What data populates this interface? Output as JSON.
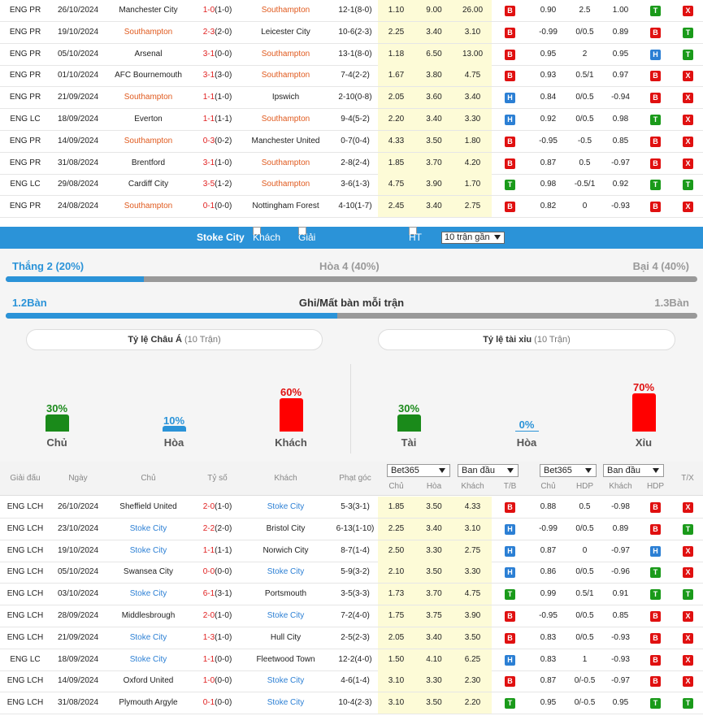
{
  "top_matches": [
    {
      "league": "ENG PR",
      "date": "26/10/2024",
      "home": "Manchester City",
      "home_hl": false,
      "score": "1-0",
      "ht": "(1-0)",
      "away": "Southampton",
      "away_hl": true,
      "corner": "12-1(8-0)",
      "o1": "1.10",
      "o2": "9.00",
      "o3": "26.00",
      "tb": "B",
      "h1": "0.90",
      "hdp": "2.5",
      "h2": "1.00",
      "r1": "T",
      "r2": "X"
    },
    {
      "league": "ENG PR",
      "date": "19/10/2024",
      "home": "Southampton",
      "home_hl": true,
      "score": "2-3",
      "ht": "(2-0)",
      "away": "Leicester City",
      "away_hl": false,
      "corner": "10-6(2-3)",
      "o1": "2.25",
      "o2": "3.40",
      "o3": "3.10",
      "tb": "B",
      "h1": "-0.99",
      "hdp": "0/0.5",
      "h2": "0.89",
      "r1": "B",
      "r2": "T"
    },
    {
      "league": "ENG PR",
      "date": "05/10/2024",
      "home": "Arsenal",
      "home_hl": false,
      "score": "3-1",
      "ht": "(0-0)",
      "away": "Southampton",
      "away_hl": true,
      "corner": "13-1(8-0)",
      "o1": "1.18",
      "o2": "6.50",
      "o3": "13.00",
      "tb": "B",
      "h1": "0.95",
      "hdp": "2",
      "h2": "0.95",
      "r1": "H",
      "r2": "T"
    },
    {
      "league": "ENG PR",
      "date": "01/10/2024",
      "home": "AFC Bournemouth",
      "home_hl": false,
      "score": "3-1",
      "ht": "(3-0)",
      "away": "Southampton",
      "away_hl": true,
      "corner": "7-4(2-2)",
      "o1": "1.67",
      "o2": "3.80",
      "o3": "4.75",
      "tb": "B",
      "h1": "0.93",
      "hdp": "0.5/1",
      "h2": "0.97",
      "r1": "B",
      "r2": "X"
    },
    {
      "league": "ENG PR",
      "date": "21/09/2024",
      "home": "Southampton",
      "home_hl": true,
      "score": "1-1",
      "ht": "(1-0)",
      "away": "Ipswich",
      "away_hl": false,
      "corner": "2-10(0-8)",
      "o1": "2.05",
      "o2": "3.60",
      "o3": "3.40",
      "tb": "H",
      "h1": "0.84",
      "hdp": "0/0.5",
      "h2": "-0.94",
      "r1": "B",
      "r2": "X"
    },
    {
      "league": "ENG LC",
      "date": "18/09/2024",
      "home": "Everton",
      "home_hl": false,
      "score": "1-1",
      "ht": "(1-1)",
      "away": "Southampton",
      "away_hl": true,
      "corner": "9-4(5-2)",
      "o1": "2.20",
      "o2": "3.40",
      "o3": "3.30",
      "tb": "H",
      "h1": "0.92",
      "hdp": "0/0.5",
      "h2": "0.98",
      "r1": "T",
      "r2": "X"
    },
    {
      "league": "ENG PR",
      "date": "14/09/2024",
      "home": "Southampton",
      "home_hl": true,
      "score": "0-3",
      "ht": "(0-2)",
      "away": "Manchester United",
      "away_hl": false,
      "corner": "0-7(0-4)",
      "o1": "4.33",
      "o2": "3.50",
      "o3": "1.80",
      "tb": "B",
      "h1": "-0.95",
      "hdp": "-0.5",
      "h2": "0.85",
      "r1": "B",
      "r2": "X"
    },
    {
      "league": "ENG PR",
      "date": "31/08/2024",
      "home": "Brentford",
      "home_hl": false,
      "score": "3-1",
      "ht": "(1-0)",
      "away": "Southampton",
      "away_hl": true,
      "corner": "2-8(2-4)",
      "o1": "1.85",
      "o2": "3.70",
      "o3": "4.20",
      "tb": "B",
      "h1": "0.87",
      "hdp": "0.5",
      "h2": "-0.97",
      "r1": "B",
      "r2": "X"
    },
    {
      "league": "ENG LC",
      "date": "29/08/2024",
      "home": "Cardiff City",
      "home_hl": false,
      "score": "3-5",
      "ht": "(1-2)",
      "away": "Southampton",
      "away_hl": true,
      "corner": "3-6(1-3)",
      "o1": "4.75",
      "o2": "3.90",
      "o3": "1.70",
      "tb": "T",
      "h1": "0.98",
      "hdp": "-0.5/1",
      "h2": "0.92",
      "r1": "T",
      "r2": "T"
    },
    {
      "league": "ENG PR",
      "date": "24/08/2024",
      "home": "Southampton",
      "home_hl": true,
      "score": "0-1",
      "ht": "(0-0)",
      "away": "Nottingham Forest",
      "away_hl": false,
      "corner": "4-10(1-7)",
      "o1": "2.45",
      "o2": "3.40",
      "o3": "2.75",
      "tb": "B",
      "h1": "0.82",
      "hdp": "0",
      "h2": "-0.93",
      "r1": "B",
      "r2": "X"
    }
  ],
  "filter": {
    "team": "Stoke City",
    "away": "Khách",
    "similar": "Giải đấu tương đồng",
    "ht": "HT",
    "range": "10 trận gần"
  },
  "summary": {
    "win": "Thắng 2 (20%)",
    "draw": "Hòa 4 (40%)",
    "loss": "Bại 4 (40%)",
    "win_frac": 0.2,
    "goals_title": "Ghi/Mất bàn mỗi trận",
    "goals_for": "1.2Bàn",
    "goals_against": "1.3Bàn"
  },
  "asian": {
    "title": "Tỷ lệ Châu Á",
    "sub": "(10 Trận)",
    "items": [
      {
        "pct": "30%",
        "label": "Chủ"
      },
      {
        "pct": "10%",
        "label": "Hòa"
      },
      {
        "pct": "60%",
        "label": "Khách"
      }
    ]
  },
  "ou": {
    "title": "Tỷ lệ tài xỉu",
    "sub": "(10 Trận)",
    "items": [
      {
        "pct": "30%",
        "label": "Tài"
      },
      {
        "pct": "0%",
        "label": "Hòa"
      },
      {
        "pct": "70%",
        "label": "Xỉu"
      }
    ]
  },
  "table_header": {
    "league": "Giải đấu",
    "date": "Ngày",
    "home": "Chủ",
    "score": "Tỷ số",
    "away": "Khách",
    "corner": "Phạt góc",
    "book1": "Bet365",
    "book2": "Ban đầu",
    "book3": "Bet365",
    "book4": "Ban đầu",
    "tx": "T/X",
    "o1": "Chủ",
    "o2": "Hòa",
    "o3": "Khách",
    "tb": "T/B",
    "h1": "Chủ",
    "hdp": "HDP",
    "h2": "Khách",
    "hdp2": "HDP"
  },
  "bottom_matches": [
    {
      "league": "ENG LCH",
      "date": "26/10/2024",
      "home": "Sheffield United",
      "home_hl": false,
      "score": "2-0",
      "ht": "(1-0)",
      "away": "Stoke City",
      "away_hl": true,
      "corner": "5-3(3-1)",
      "o1": "1.85",
      "o2": "3.50",
      "o3": "4.33",
      "tb": "B",
      "h1": "0.88",
      "hdp": "0.5",
      "h2": "-0.98",
      "r1": "B",
      "r2": "X"
    },
    {
      "league": "ENG LCH",
      "date": "23/10/2024",
      "home": "Stoke City",
      "home_hl": true,
      "score": "2-2",
      "ht": "(2-0)",
      "away": "Bristol City",
      "away_hl": false,
      "corner": "6-13(1-10)",
      "o1": "2.25",
      "o2": "3.40",
      "o3": "3.10",
      "tb": "H",
      "h1": "-0.99",
      "hdp": "0/0.5",
      "h2": "0.89",
      "r1": "B",
      "r2": "T"
    },
    {
      "league": "ENG LCH",
      "date": "19/10/2024",
      "home": "Stoke City",
      "home_hl": true,
      "score": "1-1",
      "ht": "(1-1)",
      "away": "Norwich City",
      "away_hl": false,
      "corner": "8-7(1-4)",
      "o1": "2.50",
      "o2": "3.30",
      "o3": "2.75",
      "tb": "H",
      "h1": "0.87",
      "hdp": "0",
      "h2": "-0.97",
      "r1": "H",
      "r2": "X"
    },
    {
      "league": "ENG LCH",
      "date": "05/10/2024",
      "home": "Swansea City",
      "home_hl": false,
      "score": "0-0",
      "ht": "(0-0)",
      "away": "Stoke City",
      "away_hl": true,
      "corner": "5-9(3-2)",
      "o1": "2.10",
      "o2": "3.50",
      "o3": "3.30",
      "tb": "H",
      "h1": "0.86",
      "hdp": "0/0.5",
      "h2": "-0.96",
      "r1": "T",
      "r2": "X"
    },
    {
      "league": "ENG LCH",
      "date": "03/10/2024",
      "home": "Stoke City",
      "home_hl": true,
      "score": "6-1",
      "ht": "(3-1)",
      "away": "Portsmouth",
      "away_hl": false,
      "corner": "3-5(3-3)",
      "o1": "1.73",
      "o2": "3.70",
      "o3": "4.75",
      "tb": "T",
      "h1": "0.99",
      "hdp": "0.5/1",
      "h2": "0.91",
      "r1": "T",
      "r2": "T"
    },
    {
      "league": "ENG LCH",
      "date": "28/09/2024",
      "home": "Middlesbrough",
      "home_hl": false,
      "score": "2-0",
      "ht": "(1-0)",
      "away": "Stoke City",
      "away_hl": true,
      "corner": "7-2(4-0)",
      "o1": "1.75",
      "o2": "3.75",
      "o3": "3.90",
      "tb": "B",
      "h1": "-0.95",
      "hdp": "0/0.5",
      "h2": "0.85",
      "r1": "B",
      "r2": "X"
    },
    {
      "league": "ENG LCH",
      "date": "21/09/2024",
      "home": "Stoke City",
      "home_hl": true,
      "score": "1-3",
      "ht": "(1-0)",
      "away": "Hull City",
      "away_hl": false,
      "corner": "2-5(2-3)",
      "o1": "2.05",
      "o2": "3.40",
      "o3": "3.50",
      "tb": "B",
      "h1": "0.83",
      "hdp": "0/0.5",
      "h2": "-0.93",
      "r1": "B",
      "r2": "X"
    },
    {
      "league": "ENG LC",
      "date": "18/09/2024",
      "home": "Stoke City",
      "home_hl": true,
      "score": "1-1",
      "ht": "(0-0)",
      "away": "Fleetwood Town",
      "away_hl": false,
      "corner": "12-2(4-0)",
      "o1": "1.50",
      "o2": "4.10",
      "o3": "6.25",
      "tb": "H",
      "h1": "0.83",
      "hdp": "1",
      "h2": "-0.93",
      "r1": "B",
      "r2": "X"
    },
    {
      "league": "ENG LCH",
      "date": "14/09/2024",
      "home": "Oxford United",
      "home_hl": false,
      "score": "1-0",
      "ht": "(0-0)",
      "away": "Stoke City",
      "away_hl": true,
      "corner": "4-6(1-4)",
      "o1": "3.10",
      "o2": "3.30",
      "o3": "2.30",
      "tb": "B",
      "h1": "0.87",
      "hdp": "0/-0.5",
      "h2": "-0.97",
      "r1": "B",
      "r2": "X"
    },
    {
      "league": "ENG LCH",
      "date": "31/08/2024",
      "home": "Plymouth Argyle",
      "home_hl": false,
      "score": "0-1",
      "ht": "(0-0)",
      "away": "Stoke City",
      "away_hl": true,
      "corner": "10-4(2-3)",
      "o1": "3.10",
      "o2": "3.50",
      "o3": "2.20",
      "tb": "T",
      "h1": "0.95",
      "hdp": "0/-0.5",
      "h2": "0.95",
      "r1": "T",
      "r2": "T"
    }
  ]
}
